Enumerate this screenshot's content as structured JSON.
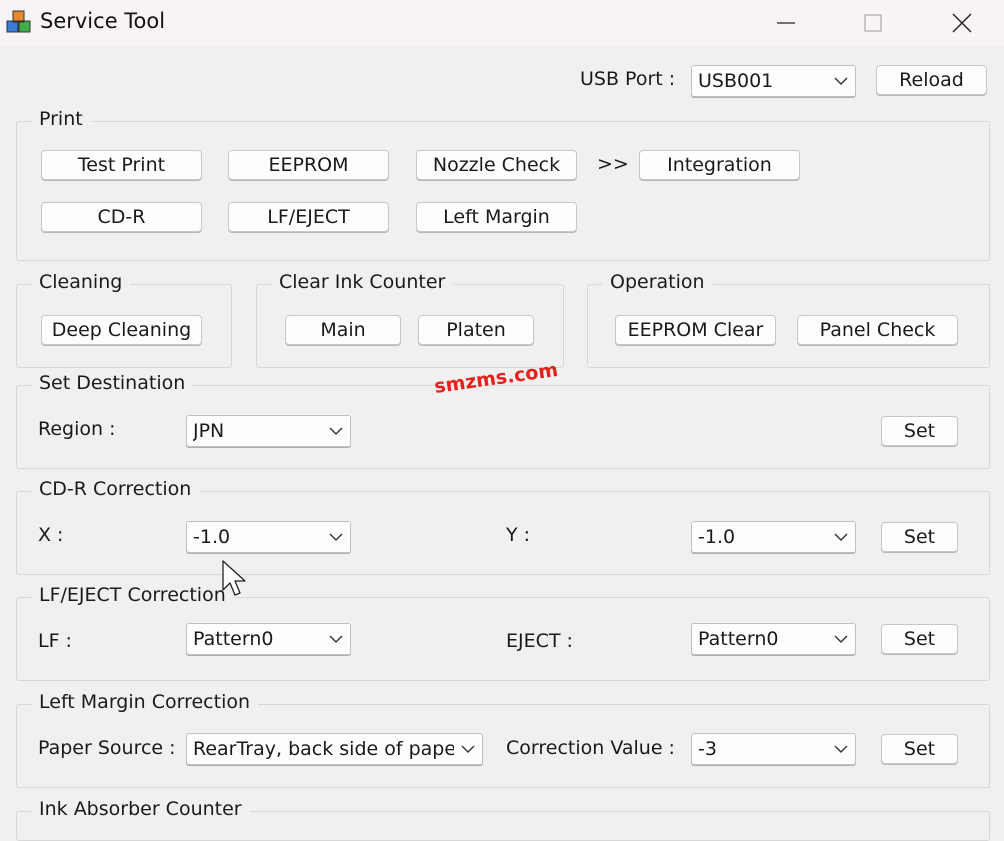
{
  "window": {
    "title": "Service Tool",
    "app_icon": "service-tool-app-icon",
    "controls": [
      "minimize-icon",
      "maximize-icon",
      "close-icon"
    ]
  },
  "usb": {
    "label": "USB Port :",
    "selected": "USB001",
    "reload_label": "Reload"
  },
  "print": {
    "legend": "Print",
    "test_print": "Test Print",
    "eeprom": "EEPROM",
    "nozzle_check": "Nozzle Check",
    "arrows": ">>",
    "integration": "Integration",
    "cd_r": "CD-R",
    "lf_eject": "LF/EJECT",
    "left_margin": "Left Margin"
  },
  "cleaning": {
    "legend": "Cleaning",
    "deep_cleaning": "Deep Cleaning"
  },
  "clear_ink_counter": {
    "legend": "Clear Ink Counter",
    "main": "Main",
    "platen": "Platen"
  },
  "operation": {
    "legend": "Operation",
    "eeprom_clear": "EEPROM Clear",
    "panel_check": "Panel Check"
  },
  "set_destination": {
    "legend": "Set Destination",
    "region_label": "Region :",
    "region_value": "JPN",
    "set_label": "Set"
  },
  "cdr_correction": {
    "legend": "CD-R Correction",
    "x_label": "X :",
    "x_value": "-1.0",
    "y_label": "Y :",
    "y_value": "-1.0",
    "set_label": "Set"
  },
  "lf_eject_correction": {
    "legend": "LF/EJECT Correction",
    "lf_label": "LF :",
    "lf_value": "Pattern0",
    "eject_label": "EJECT :",
    "eject_value": "Pattern0",
    "set_label": "Set"
  },
  "left_margin_correction": {
    "legend": "Left Margin Correction",
    "paper_source_label": "Paper Source :",
    "paper_source_value": "RearTray, back side of paper",
    "correction_label": "Correction Value :",
    "correction_value": "-3",
    "set_label": "Set"
  },
  "ink_absorber": {
    "legend": "Ink Absorber Counter"
  },
  "watermark": "smzms.com",
  "colors": {
    "background": "#f0f0f0",
    "titlebar": "#f7f3f7",
    "watermark": "#e8201a",
    "border": "#d8d8d8"
  }
}
